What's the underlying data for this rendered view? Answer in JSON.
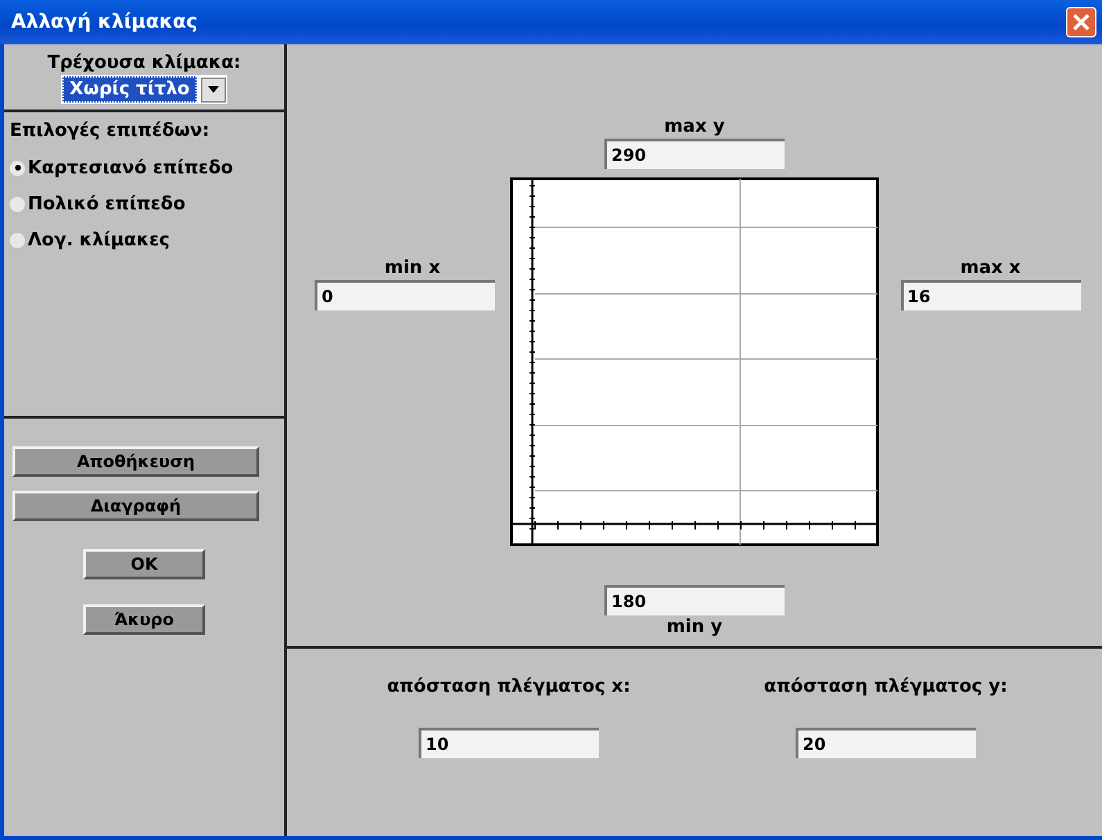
{
  "window": {
    "title": "Αλλαγή κλίμακας"
  },
  "current_scale": {
    "label": "Τρέχουσα κλίμακα:",
    "value": "Χωρίς τίτλο"
  },
  "plane_options": {
    "label": "Επιλογές επιπέδων:",
    "items": [
      {
        "label": "Καρτεσιανό επίπεδο",
        "selected": true
      },
      {
        "label": "Πολικό επίπεδο",
        "selected": false
      },
      {
        "label": "Λογ. κλίμακες",
        "selected": false
      }
    ]
  },
  "side_buttons": [
    "Αποθήκευση",
    "Διαγραφή"
  ],
  "dialog_buttons": [
    "OK",
    "Άκυρο"
  ],
  "max_y": {
    "label": "max y",
    "value": "290"
  },
  "min_x": {
    "label": "min x",
    "value": "0"
  },
  "max_x": {
    "label": "max x",
    "value": "16"
  },
  "min_y": {
    "label": "min y",
    "value": "180"
  },
  "grid_x": {
    "label": "απόσταση πλέγματος x:",
    "value": "10"
  },
  "grid_y": {
    "label": "απόσταση πλέγματος y:",
    "value": "20"
  }
}
